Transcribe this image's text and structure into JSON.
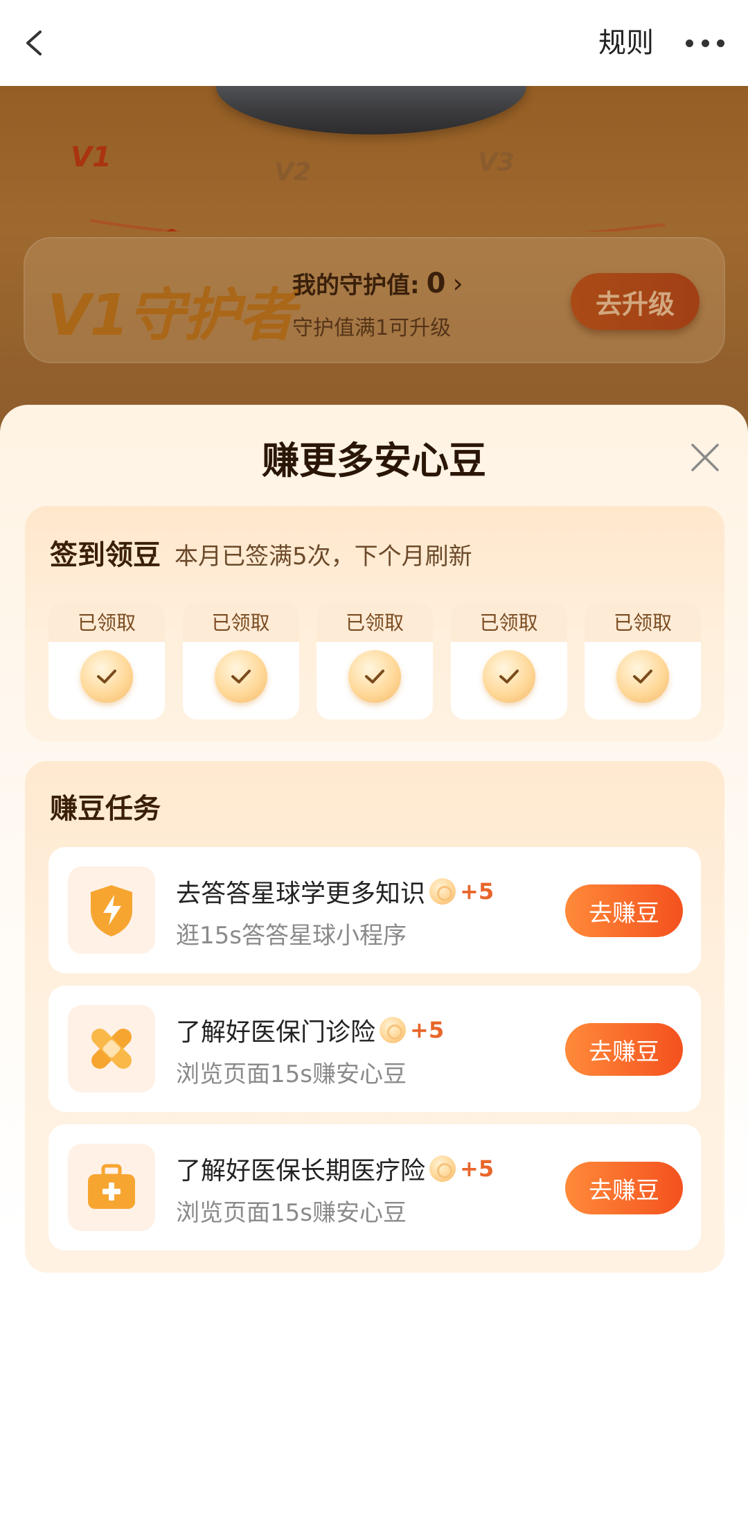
{
  "nav": {
    "rules_label": "规则"
  },
  "hero": {
    "levels": [
      "V1",
      "V2",
      "V3"
    ],
    "level_name": "V1守护者",
    "guard_label": "我的守护值:",
    "guard_value": "0",
    "guard_hint": "守护值满1可升级",
    "upgrade_label": "去升级"
  },
  "sheet": {
    "title": "赚更多安心豆",
    "checkin": {
      "title": "签到领豆",
      "subtitle": "本月已签满5次，下个月刷新",
      "days": [
        {
          "label": "已领取"
        },
        {
          "label": "已领取"
        },
        {
          "label": "已领取"
        },
        {
          "label": "已领取"
        },
        {
          "label": "已领取"
        }
      ]
    },
    "tasks": {
      "title": "赚豆任务",
      "items": [
        {
          "icon": "shield-bolt-icon",
          "title": "去答答星球学更多知识",
          "reward": "+5",
          "subtitle": "逛15s答答星球小程序",
          "button": "去赚豆"
        },
        {
          "icon": "bandage-icon",
          "title": "了解好医保门诊险",
          "reward": "+5",
          "subtitle": "浏览页面15s赚安心豆",
          "button": "去赚豆"
        },
        {
          "icon": "medical-kit-icon",
          "title": "了解好医保长期医疗险",
          "reward": "+5",
          "subtitle": "浏览页面15s赚安心豆",
          "button": "去赚豆"
        }
      ]
    }
  },
  "colors": {
    "accent_orange": "#f4511e",
    "reward_orange": "#e8662b",
    "hero_brown": "#a86d2d"
  }
}
